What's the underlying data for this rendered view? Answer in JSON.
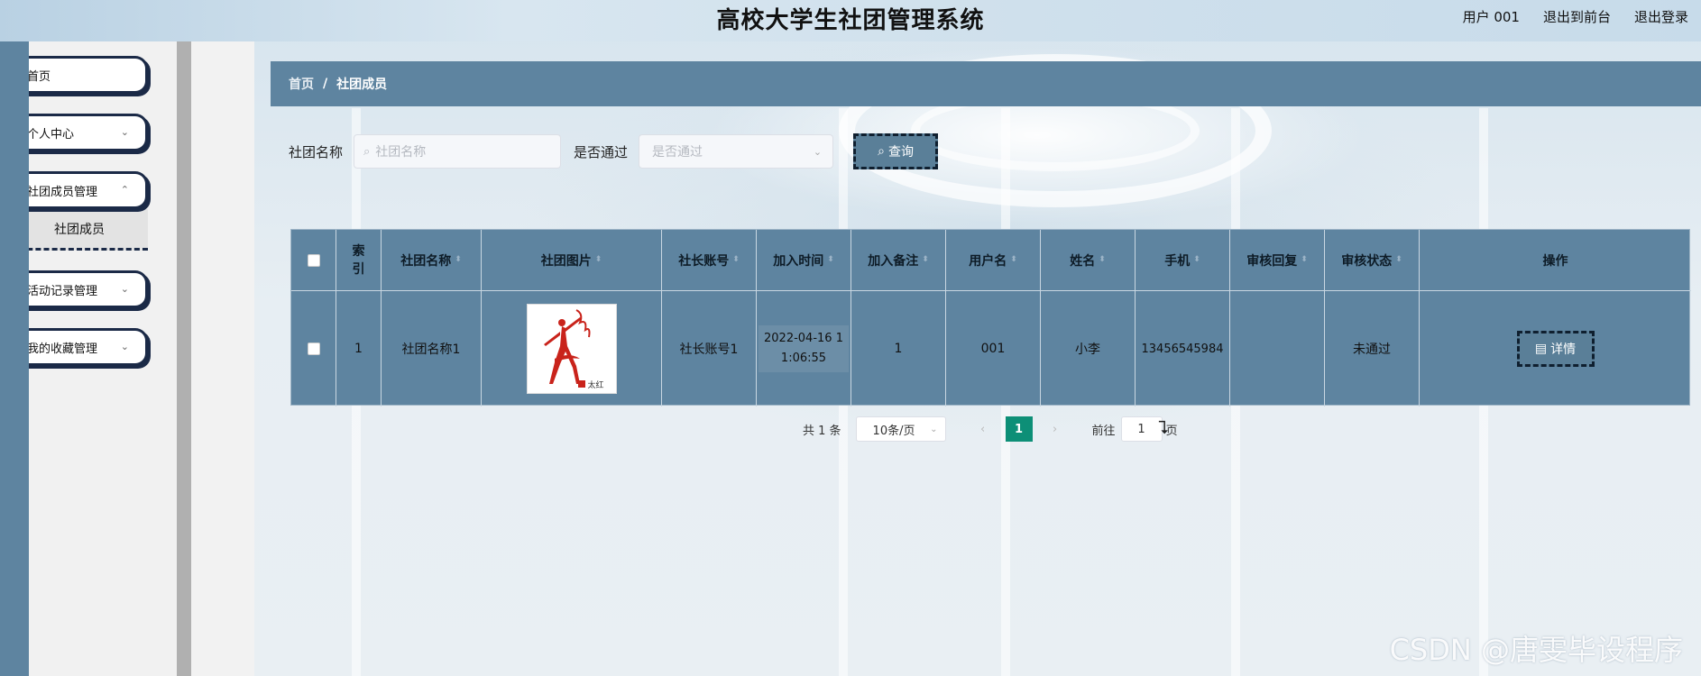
{
  "app": {
    "title": "高校大学生社团管理系统",
    "user_label": "用户 001",
    "front_link": "退出到前台",
    "logout_link": "退出登录"
  },
  "sidebar": {
    "items": [
      {
        "label": "首页"
      },
      {
        "label": "个人中心"
      },
      {
        "label": "社团成员管理"
      },
      {
        "label": "活动记录管理"
      },
      {
        "label": "我的收藏管理"
      }
    ],
    "submenu_active": "社团成员"
  },
  "breadcrumb": {
    "home": "首页",
    "separator": "/",
    "current": "社团成员"
  },
  "search": {
    "name_label": "社团名称",
    "name_placeholder": "社团名称",
    "status_label": "是否通过",
    "status_placeholder": "是否通过",
    "query_button": "查询"
  },
  "table": {
    "columns": [
      "索引",
      "社团名称",
      "社团图片",
      "社长账号",
      "加入时间",
      "加入备注",
      "用户名",
      "姓名",
      "手机",
      "审核回复",
      "审核状态",
      "操作"
    ],
    "rows": [
      {
        "index": "1",
        "club_name": "社团名称1",
        "leader_account": "社长账号1",
        "join_time_line1": "2022-04-16 1",
        "join_time_line2": "1:06:55",
        "join_note": "1",
        "username": "001",
        "name": "小李",
        "phone": "13456545984",
        "review_reply": "",
        "review_status": "未通过",
        "action": "详情",
        "image_caption": "太红"
      }
    ]
  },
  "pagination": {
    "total": "共 1 条",
    "page_size": "10条/页",
    "prev": "‹",
    "next": "›",
    "current_page": "1",
    "goto_label": "前往",
    "goto_value": "1",
    "page_suffix": "页"
  },
  "watermark": "CSDN @唐雯毕设程序",
  "colors": {
    "accent": "#5e84a0",
    "page_active": "#0d8f77",
    "border_dark": "#1b2a47"
  }
}
